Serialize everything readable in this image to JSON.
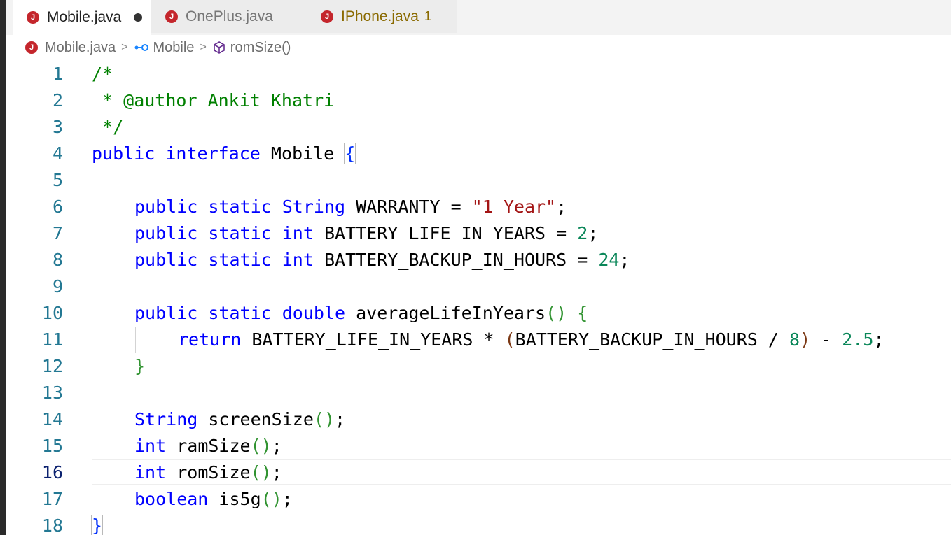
{
  "tabs": [
    {
      "label": "Mobile.java",
      "icon": "java-file-icon",
      "state": "active, unsaved"
    },
    {
      "label": "OnePlus.java",
      "icon": "java-file-icon",
      "state": "inactive"
    },
    {
      "label": "IPhone.java",
      "icon": "java-file-icon",
      "state": "warning",
      "problems": "1"
    }
  ],
  "breadcrumb": {
    "file": "Mobile.java",
    "interface": "Mobile",
    "method": "romSize()",
    "separator": ">"
  },
  "editor": {
    "current_line": 16,
    "line_numbers": [
      "1",
      "2",
      "3",
      "4",
      "5",
      "6",
      "7",
      "8",
      "9",
      "10",
      "11",
      "12",
      "13",
      "14",
      "15",
      "16",
      "17",
      "18"
    ],
    "tokens": {
      "l1": "/*",
      "l2": " * @author Ankit Khatri",
      "l3": " */",
      "public": "public",
      "interface": "interface",
      "static": "static",
      "String": "String",
      "int": "int",
      "double": "double",
      "boolean": "boolean",
      "return": "return",
      "Mobile": "Mobile",
      "WARRANTY": "WARRANTY",
      "warranty_value": "\"1 Year\"",
      "BATTERY_LIFE_IN_YEARS": "BATTERY_LIFE_IN_YEARS",
      "BATTERY_BACKUP_IN_HOURS": "BATTERY_BACKUP_IN_HOURS",
      "num_2": "2",
      "num_24": "24",
      "num_8": "8",
      "num_2_5": "2.5",
      "averageLifeInYears": "averageLifeInYears",
      "screenSize": "screenSize",
      "ramSize": "ramSize",
      "romSize": "romSize",
      "is5g": "is5g",
      "eq": " = ",
      "semi": ";",
      "times": " * ",
      "div": " / ",
      "minus": " - ",
      "lbrace": "{",
      "rbrace": "}",
      "lparen": "(",
      "rparen": ")",
      "parens": "()"
    }
  },
  "colors": {
    "comment": "#008000",
    "keyword": "#0000ff",
    "type": "#267f99",
    "string": "#a31515",
    "number": "#098658",
    "line_number": "#237893",
    "error_icon": "#c4262c"
  }
}
